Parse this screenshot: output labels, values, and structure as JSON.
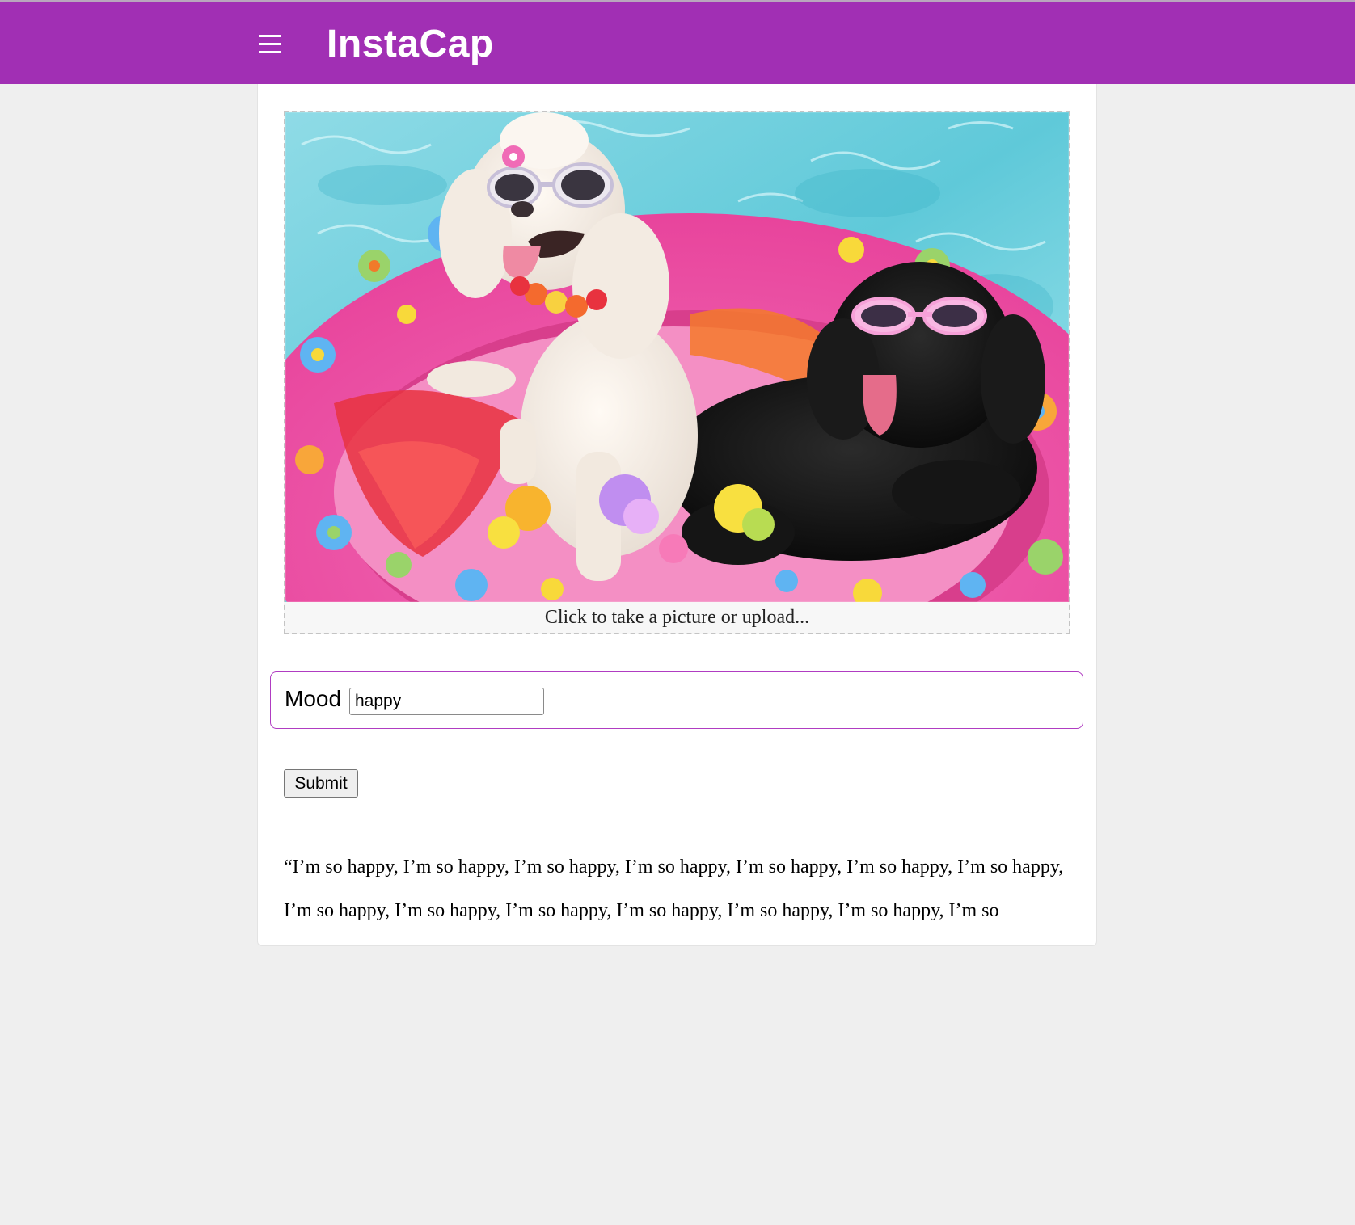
{
  "header": {
    "title": "InstaCap",
    "background_color": "#a12fb4",
    "menu_icon": "hamburger-menu-icon"
  },
  "upload": {
    "image_alt": "Two poodles wearing sunglasses on a floral pool float",
    "prompt": "Click to take a picture or upload..."
  },
  "mood": {
    "label": "Mood",
    "value": "happy"
  },
  "submit": {
    "label": "Submit"
  },
  "result": {
    "caption": "“I’m so happy, I’m so happy, I’m so happy, I’m so happy, I’m so happy, I’m so happy, I’m so happy, I’m so happy, I’m so happy, I’m so happy, I’m so happy, I’m so happy, I’m so happy, I’m so"
  },
  "colors": {
    "accent": "#a12fb4",
    "mood_border": "#b03cc2",
    "page_background": "#efefef"
  }
}
